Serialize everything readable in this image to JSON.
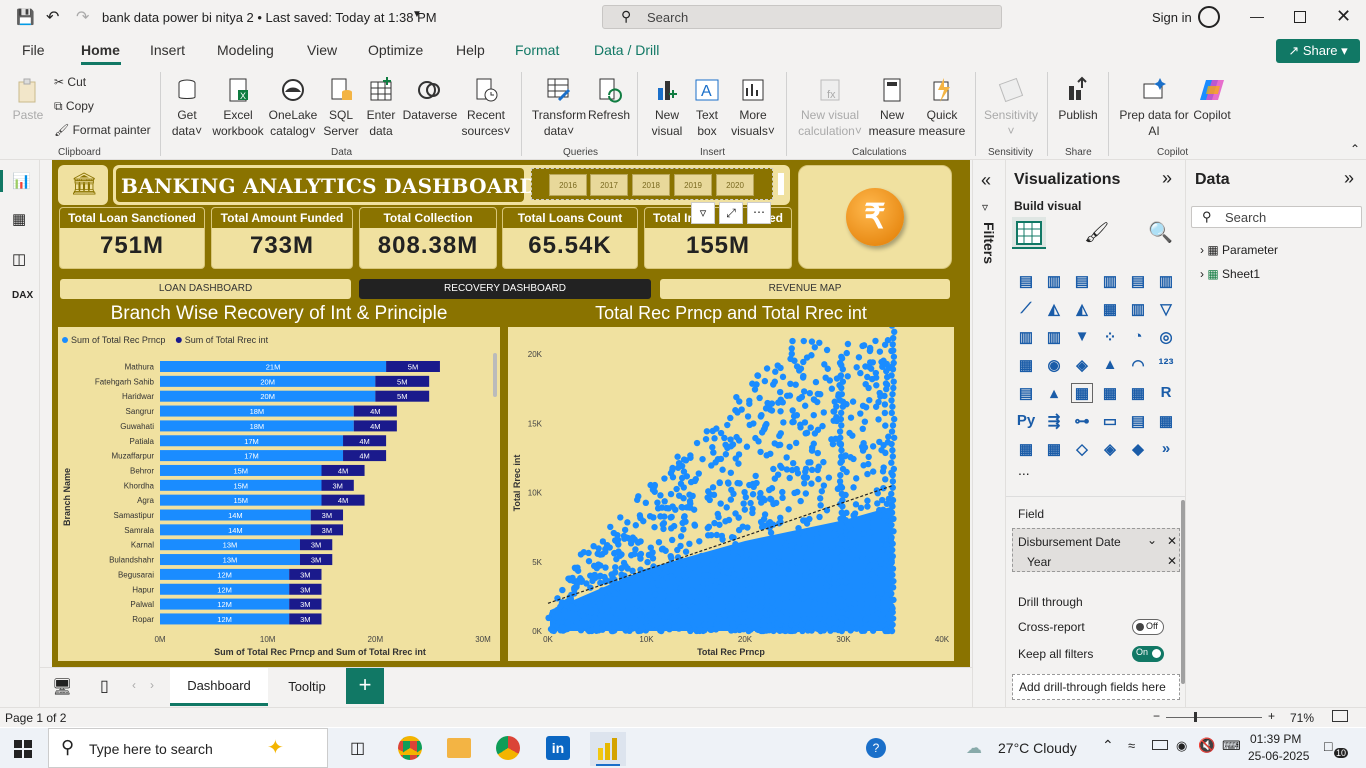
{
  "titlebar": {
    "doc_title": "bank data power bi nitya 2 • Last saved: Today at 1:38 PM",
    "search_placeholder": "Search",
    "signin": "Sign in"
  },
  "menu": [
    "File",
    "Home",
    "Insert",
    "Modeling",
    "View",
    "Optimize",
    "Help",
    "Format",
    "Data / Drill"
  ],
  "share": "Share",
  "ribbon": {
    "paste": "Paste",
    "cut": "Cut",
    "copy": "Copy",
    "format_painter": "Format painter",
    "get_data": [
      "Get",
      "data"
    ],
    "excel": [
      "Excel",
      "workbook"
    ],
    "onelake": [
      "OneLake",
      "catalog"
    ],
    "sql": [
      "SQL",
      "Server"
    ],
    "enter": [
      "Enter",
      "data"
    ],
    "dataverse": "Dataverse",
    "recent": [
      "Recent",
      "sources"
    ],
    "transform": [
      "Transform",
      "data"
    ],
    "refresh": "Refresh",
    "new_visual": [
      "New",
      "visual"
    ],
    "text_box": [
      "Text",
      "box"
    ],
    "more_visuals": [
      "More",
      "visuals"
    ],
    "new_vis_calc": [
      "New visual",
      "calculation"
    ],
    "new_measure": [
      "New",
      "measure"
    ],
    "quick_measure": [
      "Quick",
      "measure"
    ],
    "sensitivity": "Sensitivity",
    "publish": "Publish",
    "prep_data": [
      "Prep data for",
      "AI"
    ],
    "copilot": "Copilot",
    "groups": [
      "Clipboard",
      "Data",
      "Queries",
      "Insert",
      "Calculations",
      "Sensitivity",
      "Share",
      "Copilot"
    ]
  },
  "dashboard": {
    "title": "BANKING ANALYTICS DASHBOARD",
    "years": [
      "2016",
      "2017",
      "2018",
      "2019",
      "2020"
    ],
    "kpis": [
      {
        "label": "Total Loan Sanctioned",
        "value": "751M"
      },
      {
        "label": "Total Amount Funded",
        "value": "733M"
      },
      {
        "label": "Total Collection",
        "value": "808.38M"
      },
      {
        "label": "Total Loans Count",
        "value": "65.54K"
      },
      {
        "label": "Total In",
        "label2": "ed",
        "value": "155M"
      }
    ],
    "nav": [
      "LOAN DASHBOARD",
      "RECOVERY DASHBOARD",
      "REVENUE MAP"
    ],
    "rupee": "₹"
  },
  "chart_data": [
    {
      "type": "bar",
      "title": "Branch Wise Recovery of Int & Principle",
      "legend": [
        "Sum of Total Rec Prncp",
        "Sum of Total Rrec int"
      ],
      "colors": [
        "#1a8cff",
        "#1a1a8c"
      ],
      "categories": [
        "Mathura",
        "Fatehgarh Sahib",
        "Haridwar",
        "Sangrur",
        "Guwahati",
        "Patiala",
        "Muzaffarpur",
        "Behror",
        "Khordha",
        "Agra",
        "Samastipur",
        "Samrala",
        "Karnal",
        "Bulandshahr",
        "Begusarai",
        "Hapur",
        "Palwal",
        "Ropar"
      ],
      "series": [
        {
          "name": "Sum of Total Rec Prncp",
          "values": [
            21,
            20,
            20,
            18,
            18,
            17,
            17,
            15,
            15,
            15,
            14,
            14,
            13,
            13,
            12,
            12,
            12,
            12
          ],
          "labels": [
            "21M",
            "20M",
            "20M",
            "18M",
            "18M",
            "17M",
            "17M",
            "15M",
            "15M",
            "15M",
            "14M",
            "14M",
            "13M",
            "13M",
            "12M",
            "12M",
            "12M",
            "12M"
          ]
        },
        {
          "name": "Sum of Total Rrec int",
          "values": [
            5,
            5,
            5,
            4,
            4,
            4,
            4,
            4,
            3,
            4,
            3,
            3,
            3,
            3,
            3,
            3,
            3,
            3
          ],
          "labels": [
            "5M",
            "5M",
            "5M",
            "4M",
            "4M",
            "4M",
            "4M",
            "4M",
            "3M",
            "4M",
            "3M",
            "3M",
            "3M",
            "3M",
            "3M",
            "3M",
            "3M",
            "3M"
          ]
        }
      ],
      "xlabel": "Sum of Total Rec Prncp and Sum of Total Rrec int",
      "ylabel": "Branch Name",
      "xticks": [
        "0M",
        "10M",
        "20M",
        "30M"
      ],
      "xlim": [
        0,
        30
      ]
    },
    {
      "type": "scatter",
      "title": "Total Rec Prncp and Total Rrec int",
      "xlabel": "Total Rec Prncp",
      "ylabel": "Total Rrec int",
      "xticks": [
        "0K",
        "10K",
        "20K",
        "30K",
        "40K"
      ],
      "yticks": [
        "0K",
        "5K",
        "10K",
        "15K",
        "20K"
      ],
      "xlim": [
        0,
        40
      ],
      "ylim": [
        0,
        20
      ],
      "color": "#1a8cff",
      "trend": [
        [
          0,
          2
        ],
        [
          35,
          10.5
        ]
      ]
    }
  ],
  "filters_label": "Filters",
  "viz_pane": {
    "title": "Visualizations",
    "build": "Build visual",
    "field": "Field",
    "field_name": "Disbursement Date",
    "field_sub": "Year",
    "drill": "Drill through",
    "cross": "Cross-report",
    "cross_state": "Off",
    "keep": "Keep all filters",
    "keep_state": "On",
    "add_drill": "Add drill-through fields here",
    "more": "..."
  },
  "data_pane": {
    "title": "Data",
    "search": "Search",
    "items": [
      "Parameter",
      "Sheet1"
    ]
  },
  "tabs": [
    "Dashboard",
    "Tooltip",
    "+"
  ],
  "status": {
    "page": "Page 1 of 2",
    "zoom": "71%"
  },
  "taskbar": {
    "search": "Type here to search",
    "weather": "27°C  Cloudy",
    "time": "01:39 PM",
    "date": "25-06-2025",
    "notif": "10"
  }
}
